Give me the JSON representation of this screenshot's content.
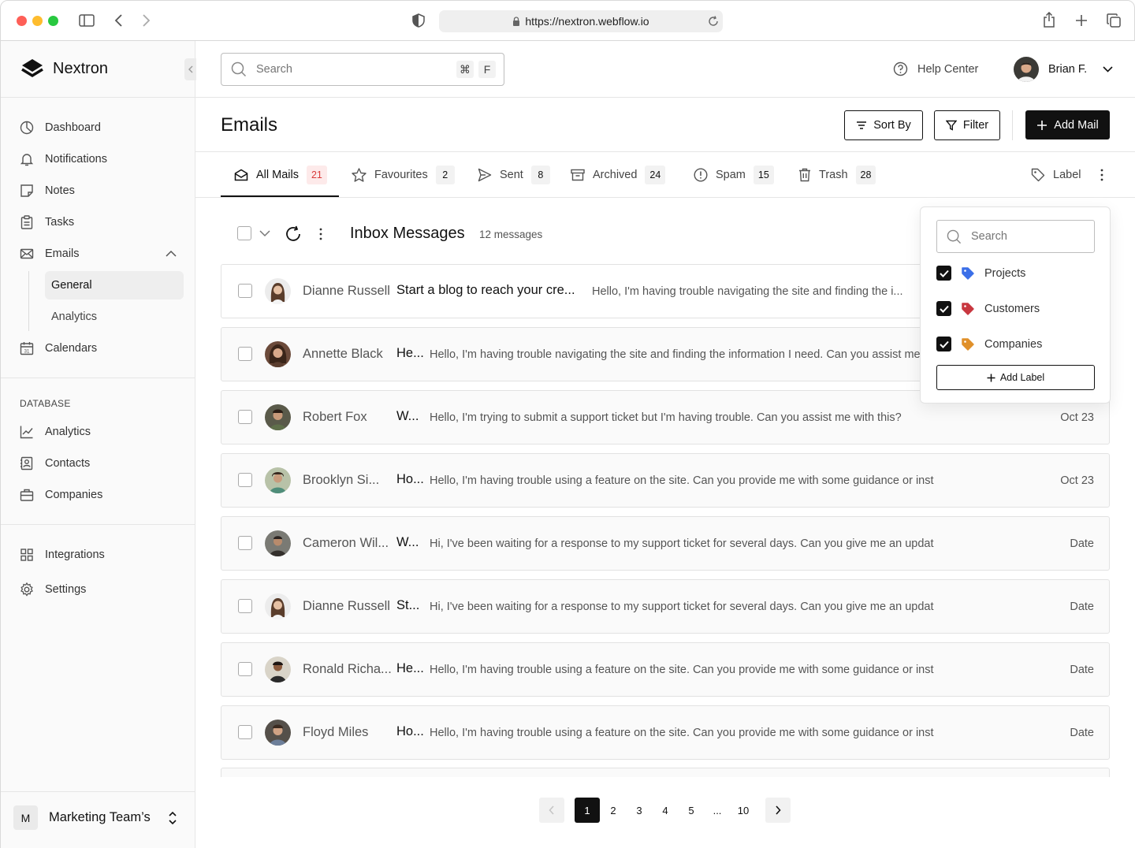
{
  "browser": {
    "url": "https://nextron.webflow.io"
  },
  "brand": {
    "name": "Nextron"
  },
  "sidebar": {
    "items": [
      {
        "label": "Dashboard",
        "icon": "pie-chart-icon"
      },
      {
        "label": "Notifications",
        "icon": "bell-icon"
      },
      {
        "label": "Notes",
        "icon": "note-icon"
      },
      {
        "label": "Tasks",
        "icon": "clipboard-icon"
      },
      {
        "label": "Emails",
        "icon": "mail-icon",
        "expanded": true
      },
      {
        "label": "Calendars",
        "icon": "calendar-icon"
      }
    ],
    "email_sub": [
      {
        "label": "General",
        "active": true
      },
      {
        "label": "Analytics",
        "active": false
      }
    ],
    "section_label": "DATABASE",
    "database_items": [
      {
        "label": "Analytics",
        "icon": "chart-line-icon"
      },
      {
        "label": "Contacts",
        "icon": "contacts-icon"
      },
      {
        "label": "Companies",
        "icon": "briefcase-icon"
      }
    ],
    "bottom_items": [
      {
        "label": "Integrations",
        "icon": "grid-icon"
      },
      {
        "label": "Settings",
        "icon": "gear-icon"
      }
    ],
    "team": {
      "initial": "M",
      "name": "Marketing Team’s"
    }
  },
  "header": {
    "search_placeholder": "Search",
    "shortcut_keys": [
      "⌘",
      "F"
    ],
    "help_label": "Help Center",
    "user_name": "Brian F."
  },
  "page": {
    "title": "Emails",
    "sort_label": "Sort By",
    "filter_label": "Filter",
    "add_label": "Add Mail"
  },
  "tabs": [
    {
      "label": "All Mails",
      "count": "21",
      "icon": "inbox-icon",
      "active": true
    },
    {
      "label": "Favourites",
      "count": "2",
      "icon": "star-icon"
    },
    {
      "label": "Sent",
      "count": "8",
      "icon": "send-icon"
    },
    {
      "label": "Archived",
      "count": "24",
      "icon": "archive-icon"
    },
    {
      "label": "Spam",
      "count": "15",
      "icon": "alert-icon"
    },
    {
      "label": "Trash",
      "count": "28",
      "icon": "trash-icon"
    }
  ],
  "label_button": "Label",
  "inbox": {
    "title": "Inbox Messages",
    "count_text": "12 messages"
  },
  "emails": [
    {
      "sender": "Dianne Russell",
      "subject": "Start a blog to reach your cre...",
      "preview": "Hello, I'm having trouble navigating the site and finding the i...",
      "date": ""
    },
    {
      "sender": "Annette Black",
      "subject": "He...",
      "preview": "Hello, I'm having trouble navigating the site and finding the information I need. Can you assist me",
      "date": ""
    },
    {
      "sender": "Robert Fox",
      "subject": "W...",
      "preview": "Hello, I'm trying to submit a support ticket but I'm having trouble. Can you assist me with this?",
      "date": "Oct 23"
    },
    {
      "sender": "Brooklyn Si...",
      "subject": "Ho...",
      "preview": "Hello, I'm having trouble using a feature on the site. Can you provide me with some guidance or inst",
      "date": "Oct 23"
    },
    {
      "sender": "Cameron Wil...",
      "subject": "W...",
      "preview": "Hi, I've been waiting for a response to my support ticket for several days. Can you give me an updat",
      "date": "Date"
    },
    {
      "sender": "Dianne Russell",
      "subject": "St...",
      "preview": "Hi, I've been waiting for a response to my support ticket for several days. Can you give me an updat",
      "date": "Date"
    },
    {
      "sender": "Ronald Richa...",
      "subject": "He...",
      "preview": "Hello, I'm having trouble using a feature on the site. Can you provide me with some guidance or inst",
      "date": "Date"
    },
    {
      "sender": "Floyd Miles",
      "subject": "Ho...",
      "preview": "Hello, I'm having trouble using a feature on the site. Can you provide me with some guidance or inst",
      "date": "Date"
    }
  ],
  "label_popover": {
    "search_placeholder": "Search",
    "labels": [
      {
        "name": "Projects",
        "color": "#3b6fe8",
        "checked": true
      },
      {
        "name": "Customers",
        "color": "#c8373f",
        "checked": true
      },
      {
        "name": "Companies",
        "color": "#e0902a",
        "checked": true
      }
    ],
    "add_label": "Add Label"
  },
  "pagination": {
    "pages": [
      "1",
      "2",
      "3",
      "4",
      "5",
      "...",
      "10"
    ],
    "current": "1"
  }
}
